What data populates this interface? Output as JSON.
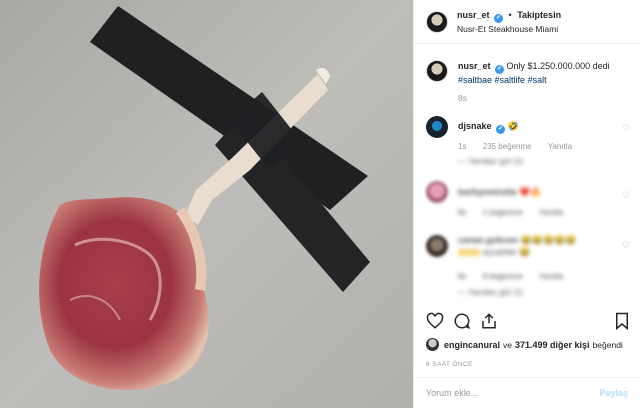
{
  "post": {
    "username": "nusr_et",
    "verified_mark": "✔",
    "follow_status": "Takiptesin",
    "location": "Nusr-Et Steakhouse Miami",
    "caption_user": "nusr_et",
    "caption_text": "Only $1.250.000.000 dedi",
    "hashtags": [
      "#saltbae",
      "#saltlife",
      "#salt"
    ],
    "caption_time": "8s"
  },
  "comments": [
    {
      "user": "djsnake",
      "verified": true,
      "text": "🤣",
      "time": "1s",
      "likes": "235 beğenme",
      "reply": "Yanıtla",
      "more": "Yanıtları gör (1)"
    },
    {
      "user": "barbyemirella",
      "text": "❤️🔥",
      "time": "8s",
      "likes": "1 beğenme",
      "reply": "Yanıtla",
      "blurred": true
    },
    {
      "user": "canan.gokcen",
      "text": "😂😂😂😂😂",
      "text2": "🙌🙌 eyvahler  😂",
      "time": "8s",
      "likes": "8 beğenme",
      "reply": "Yanıtla",
      "more": "Yanıtları gör (1)",
      "blurred": true
    }
  ],
  "actions": {
    "like_icon": "heart-icon",
    "comment_icon": "comment-icon",
    "share_icon": "share-icon",
    "save_icon": "bookmark-icon"
  },
  "likes": {
    "user": "engincanural",
    "connector": "ve",
    "count": "371.499 diğer kişi",
    "suffix": "beğendi"
  },
  "time_ago": "8 SAAT ÖNCE",
  "comment_box": {
    "placeholder": "Yorum ekle...",
    "post_label": "Paylaş"
  },
  "colors": {
    "verified": "#3897f0",
    "hashtag": "#003569",
    "post_disabled": "#b2dffc",
    "photo_bg": "#b8b7b4"
  }
}
